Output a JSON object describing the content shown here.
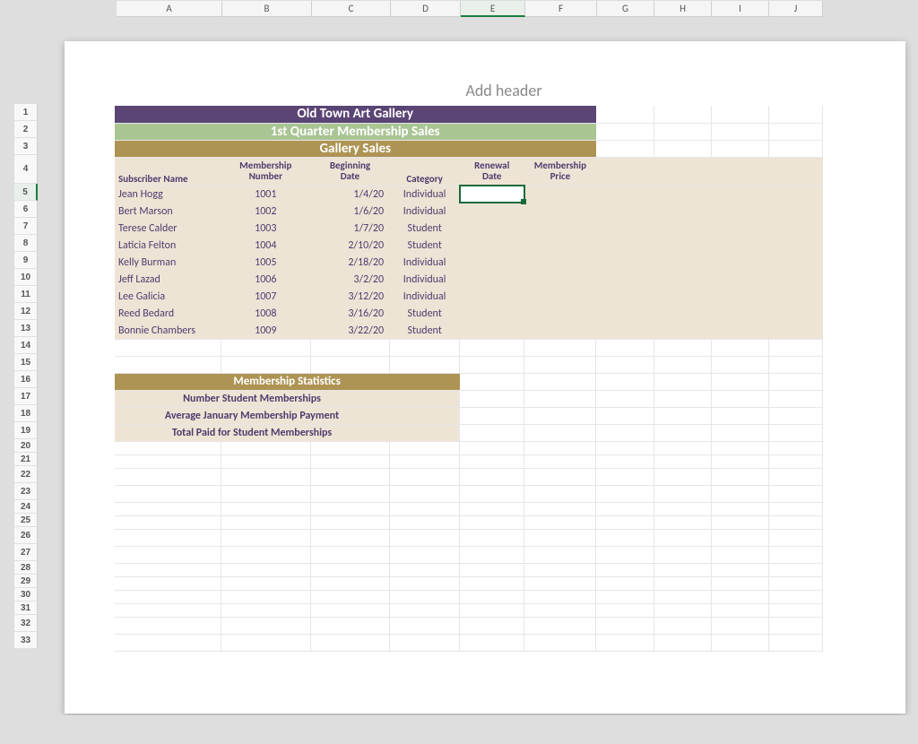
{
  "column_headers": [
    "A",
    "B",
    "C",
    "D",
    "E",
    "F",
    "G",
    "H",
    "I",
    "J"
  ],
  "row_headers": [
    "1",
    "2",
    "3",
    "4",
    "5",
    "6",
    "7",
    "8",
    "9",
    "10",
    "11",
    "12",
    "13",
    "14",
    "15",
    "16",
    "17",
    "18",
    "19",
    "20",
    "21",
    "22",
    "23",
    "24",
    "25",
    "26",
    "27",
    "28",
    "29",
    "30",
    "31",
    "32",
    "33"
  ],
  "selected_column": "E",
  "selected_row": "5",
  "add_header_text": "Add header",
  "titles": {
    "main": "Old Town Art Gallery",
    "subtitle": "1st Quarter Membership Sales",
    "section": "Gallery Sales"
  },
  "table": {
    "headers": {
      "subscriber": "Subscriber Name",
      "number": "Membership\nNumber",
      "begin": "Beginning\nDate",
      "category": "Category",
      "renewal": "Renewal\nDate",
      "price": "Membership\nPrice"
    },
    "rows": [
      {
        "name": "Jean Hogg",
        "number": "1001",
        "date": "1/4/20",
        "category": "Individual"
      },
      {
        "name": "Bert Marson",
        "number": "1002",
        "date": "1/6/20",
        "category": "Individual"
      },
      {
        "name": "Terese Calder",
        "number": "1003",
        "date": "1/7/20",
        "category": "Student"
      },
      {
        "name": "Laticia Felton",
        "number": "1004",
        "date": "2/10/20",
        "category": "Student"
      },
      {
        "name": "Kelly Burman",
        "number": "1005",
        "date": "2/18/20",
        "category": "Individual"
      },
      {
        "name": "Jeff Lazad",
        "number": "1006",
        "date": "3/2/20",
        "category": "Individual"
      },
      {
        "name": "Lee Galicia",
        "number": "1007",
        "date": "3/12/20",
        "category": "Individual"
      },
      {
        "name": "Reed Bedard",
        "number": "1008",
        "date": "3/16/20",
        "category": "Student"
      },
      {
        "name": "Bonnie Chambers",
        "number": "1009",
        "date": "3/22/20",
        "category": "Student"
      }
    ]
  },
  "stats": {
    "title": "Membership Statistics",
    "labels": {
      "num_student": "Number Student Memberships",
      "avg_jan": "Average January Membership Payment",
      "total_student": "Total Paid for Student Memberships"
    }
  },
  "colors": {
    "purple": "#5a4575",
    "green": "#a9c593",
    "tan": "#ae9454",
    "cream": "#eee4d5",
    "text": "#4f3b6e",
    "selection": "#186a3b"
  }
}
